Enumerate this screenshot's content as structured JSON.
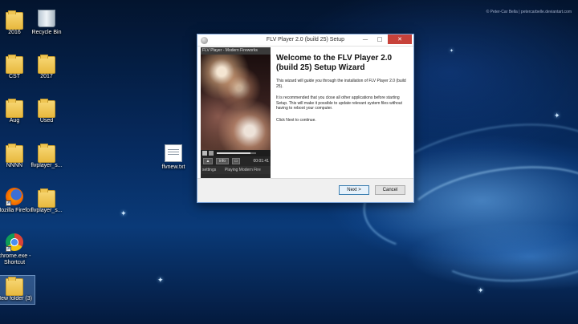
{
  "desktop": {
    "watermark": "© Peter-Car Bella | petercarbelle.deviantart.com",
    "icons": [
      {
        "label": "2016",
        "icon": "folder-icon"
      },
      {
        "label": "Recycle Bin",
        "icon": "recycle-bin-icon"
      },
      {
        "label": "CST",
        "icon": "folder-icon"
      },
      {
        "label": "2017",
        "icon": "folder-icon"
      },
      {
        "label": "Aug",
        "icon": "folder-icon"
      },
      {
        "label": "Used",
        "icon": "folder-icon"
      },
      {
        "label": "NNNN",
        "icon": "folder-icon"
      },
      {
        "label": "flvplayer_s...",
        "icon": "folder-icon"
      },
      {
        "label": "flvnew.txt",
        "icon": "text-file-icon"
      },
      {
        "label": "Mozilla Firefox",
        "icon": "firefox-icon"
      },
      {
        "label": "flvplayer_s...",
        "icon": "folder-icon"
      },
      {
        "label": "chrome.exe - Shortcut",
        "icon": "chrome-icon"
      },
      {
        "label": "New folder (3)",
        "icon": "folder-icon"
      }
    ]
  },
  "window": {
    "title": "FLV Player 2.0 (build 25) Setup",
    "controls": {
      "minimize": "—",
      "maximize": "□",
      "close": "✕"
    },
    "player": {
      "title": "FLV Player - Modern Fireworks",
      "play_glyph": "▶",
      "pause_glyph": "❚❚",
      "progress": 0.85,
      "info_label": "info",
      "time": "00:01:41",
      "settings_label": "settings",
      "status": "Playing Modern Fire"
    },
    "heading": "Welcome to the FLV Player 2.0 (build 25) Setup Wizard",
    "paragraphs": [
      "This wizard will guide you through the installation of FLV Player 2.0 (build 25).",
      "It is recommended that you close all other applications before starting Setup. This will make it possible to update relevant system files without having to reboot your computer.",
      "Click Next to continue."
    ],
    "buttons": {
      "next": "Next >",
      "cancel": "Cancel"
    }
  }
}
